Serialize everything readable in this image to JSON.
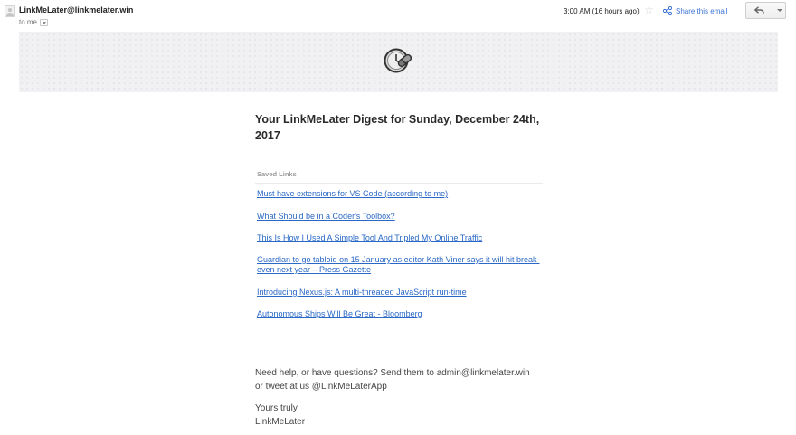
{
  "header": {
    "sender": "LinkMeLater@linkmelater.win",
    "recipient_label": "to me",
    "time": "3:00 AM (16 hours ago)",
    "share_label": "Share this email"
  },
  "email": {
    "title": "Your LinkMeLater Digest for Sunday, December 24th, 2017",
    "section_label": "Saved Links",
    "links": [
      "Must have extensions for VS Code (according to me)",
      "What Should be in a Coder's Toolbox?",
      "This Is How I Used A Simple Tool And Tripled My Online Traffic",
      "Guardian to go tabloid on 15 January as editor Kath Viner says it will hit break-even next year – Press Gazette",
      "Introducing Nexus.js: A multi-threaded JavaScript run-time",
      "Autonomous Ships Will Be Great - Bloomberg"
    ],
    "help_line1": "Need help, or have questions? Send them to admin@linkmelater.win",
    "help_line2": "or tweet at us @LinkMeLaterApp",
    "signoff": "Yours truly,",
    "signature": "LinkMeLater"
  },
  "icons": {
    "avatar": "person-icon",
    "logo": "clock-link-icon",
    "star": "star-icon",
    "share": "share-icon",
    "reply": "reply-icon",
    "more": "chevron-down-icon"
  },
  "colors": {
    "link": "#2968c6",
    "share": "#3b72d8",
    "banner": "#f1f1f3"
  }
}
